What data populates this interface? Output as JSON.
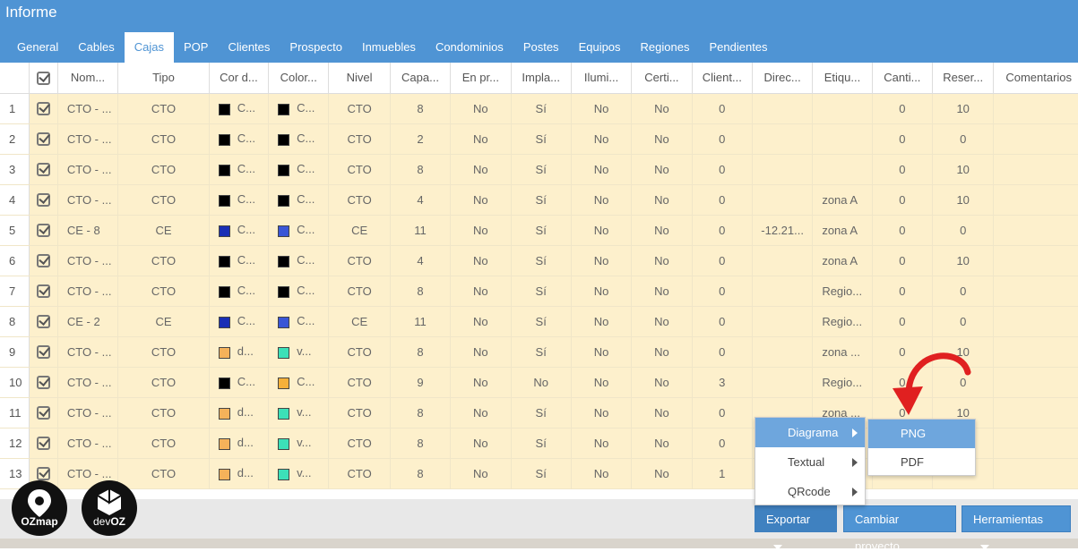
{
  "title": "Informe",
  "tabs": [
    "General",
    "Cables",
    "Cajas",
    "POP",
    "Clientes",
    "Prospecto",
    "Inmuebles",
    "Condominios",
    "Postes",
    "Equipos",
    "Regiones",
    "Pendientes"
  ],
  "active_tab": "Cajas",
  "columns": [
    "Nom...",
    "Tipo",
    "Cor d...",
    "Color...",
    "Nivel",
    "Capa...",
    "En pr...",
    "Impla...",
    "Ilumi...",
    "Certi...",
    "Client...",
    "Direc...",
    "Etiqu...",
    "Canti...",
    "Reser...",
    "Comentarios"
  ],
  "rows": [
    {
      "n": "1",
      "nome": "CTO - ...",
      "tipo": "CTO",
      "c1": "#000000",
      "t1": "C...",
      "c2": "#000000",
      "t2": "C...",
      "nivel": "CTO",
      "cap": "8",
      "enpr": "No",
      "impl": "Sí",
      "ilum": "No",
      "cert": "No",
      "cli": "0",
      "dir": "",
      "etq": "",
      "cant": "0",
      "res": "10"
    },
    {
      "n": "2",
      "nome": "CTO - ...",
      "tipo": "CTO",
      "c1": "#000000",
      "t1": "C...",
      "c2": "#000000",
      "t2": "C...",
      "nivel": "CTO",
      "cap": "2",
      "enpr": "No",
      "impl": "Sí",
      "ilum": "No",
      "cert": "No",
      "cli": "0",
      "dir": "",
      "etq": "",
      "cant": "0",
      "res": "0"
    },
    {
      "n": "3",
      "nome": "CTO - ...",
      "tipo": "CTO",
      "c1": "#000000",
      "t1": "C...",
      "c2": "#000000",
      "t2": "C...",
      "nivel": "CTO",
      "cap": "8",
      "enpr": "No",
      "impl": "Sí",
      "ilum": "No",
      "cert": "No",
      "cli": "0",
      "dir": "",
      "etq": "",
      "cant": "0",
      "res": "10"
    },
    {
      "n": "4",
      "nome": "CTO - ...",
      "tipo": "CTO",
      "c1": "#000000",
      "t1": "C...",
      "c2": "#000000",
      "t2": "C...",
      "nivel": "CTO",
      "cap": "4",
      "enpr": "No",
      "impl": "Sí",
      "ilum": "No",
      "cert": "No",
      "cli": "0",
      "dir": "",
      "etq": "zona A",
      "cant": "0",
      "res": "10"
    },
    {
      "n": "5",
      "nome": "CE - 8",
      "tipo": "CE",
      "c1": "#1a2fb5",
      "t1": "C...",
      "c2": "#3a56d6",
      "t2": "C...",
      "nivel": "CE",
      "cap": "11",
      "enpr": "No",
      "impl": "Sí",
      "ilum": "No",
      "cert": "No",
      "cli": "0",
      "dir": "-12.21...",
      "etq": "zona A",
      "cant": "0",
      "res": "0"
    },
    {
      "n": "6",
      "nome": "CTO - ...",
      "tipo": "CTO",
      "c1": "#000000",
      "t1": "C...",
      "c2": "#000000",
      "t2": "C...",
      "nivel": "CTO",
      "cap": "4",
      "enpr": "No",
      "impl": "Sí",
      "ilum": "No",
      "cert": "No",
      "cli": "0",
      "dir": "",
      "etq": "zona A",
      "cant": "0",
      "res": "10"
    },
    {
      "n": "7",
      "nome": "CTO - ...",
      "tipo": "CTO",
      "c1": "#000000",
      "t1": "C...",
      "c2": "#000000",
      "t2": "C...",
      "nivel": "CTO",
      "cap": "8",
      "enpr": "No",
      "impl": "Sí",
      "ilum": "No",
      "cert": "No",
      "cli": "0",
      "dir": "",
      "etq": "Regio...",
      "cant": "0",
      "res": "0"
    },
    {
      "n": "8",
      "nome": "CE - 2",
      "tipo": "CE",
      "c1": "#1a2fb5",
      "t1": "C...",
      "c2": "#3a56d6",
      "t2": "C...",
      "nivel": "CE",
      "cap": "11",
      "enpr": "No",
      "impl": "Sí",
      "ilum": "No",
      "cert": "No",
      "cli": "0",
      "dir": "",
      "etq": "Regio...",
      "cant": "0",
      "res": "0"
    },
    {
      "n": "9",
      "nome": "CTO - ...",
      "tipo": "CTO",
      "c1": "#f5b25a",
      "t1": "d...",
      "c2": "#3ce0b8",
      "t2": "v...",
      "nivel": "CTO",
      "cap": "8",
      "enpr": "No",
      "impl": "Sí",
      "ilum": "No",
      "cert": "No",
      "cli": "0",
      "dir": "",
      "etq": "zona ...",
      "cant": "0",
      "res": "10"
    },
    {
      "n": "10",
      "nome": "CTO - ...",
      "tipo": "CTO",
      "c1": "#000000",
      "t1": "C...",
      "c2": "#f5b03a",
      "t2": "C...",
      "nivel": "CTO",
      "cap": "9",
      "enpr": "No",
      "impl": "No",
      "ilum": "No",
      "cert": "No",
      "cli": "3",
      "dir": "",
      "etq": "Regio...",
      "cant": "0",
      "res": "0"
    },
    {
      "n": "11",
      "nome": "CTO - ...",
      "tipo": "CTO",
      "c1": "#f5b25a",
      "t1": "d...",
      "c2": "#3ce0b8",
      "t2": "v...",
      "nivel": "CTO",
      "cap": "8",
      "enpr": "No",
      "impl": "Sí",
      "ilum": "No",
      "cert": "No",
      "cli": "0",
      "dir": "",
      "etq": "zona ...",
      "cant": "0",
      "res": "10"
    },
    {
      "n": "12",
      "nome": "CTO - ...",
      "tipo": "CTO",
      "c1": "#f5b25a",
      "t1": "d...",
      "c2": "#3ce0b8",
      "t2": "v...",
      "nivel": "CTO",
      "cap": "8",
      "enpr": "No",
      "impl": "Sí",
      "ilum": "No",
      "cert": "No",
      "cli": "0",
      "dir": "",
      "etq": "",
      "cant": "",
      "res": ""
    },
    {
      "n": "13",
      "nome": "CTO - ...",
      "tipo": "CTO",
      "c1": "#f5b25a",
      "t1": "d...",
      "c2": "#3ce0b8",
      "t2": "v...",
      "nivel": "CTO",
      "cap": "8",
      "enpr": "No",
      "impl": "Sí",
      "ilum": "No",
      "cert": "No",
      "cli": "1",
      "dir": "",
      "etq": "",
      "cant": "",
      "res": ""
    }
  ],
  "logos": {
    "left": "OZmap",
    "right_prefix": "dev",
    "right_suffix": "OZ"
  },
  "buttons": {
    "export": "Exportar",
    "project": "Cambiar proyecto",
    "tools": "Herramientas"
  },
  "menu": {
    "items": [
      "Diagrama",
      "Textual",
      "QRcode"
    ],
    "active": "Diagrama"
  },
  "submenu": {
    "items": [
      "PNG",
      "PDF"
    ],
    "active": "PNG"
  },
  "colors": {
    "header": "#4f94d4",
    "row_bg": "#fdf0cc",
    "menu_active": "#6ea6dd",
    "arrow": "#e02020"
  }
}
